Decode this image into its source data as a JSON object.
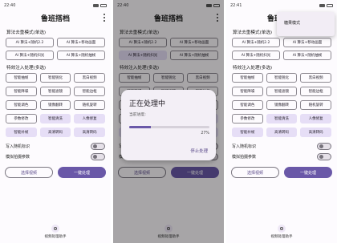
{
  "time": "22:40",
  "time3": "22:41",
  "title": "鲁班搭档",
  "section1": "算法去重模式(单选)",
  "algo": [
    "AI 算法+随机2.2",
    "AI 算法+移动画面",
    "AI 算法+随机扫光",
    "AI 算法+随机抽帧"
  ],
  "section2": "特效注入处理(多选)",
  "effects": [
    "智能抽帧",
    "智能锐化",
    "黑白视频",
    "智能降噪",
    "智能滤镜",
    "智能边框",
    "智能调色",
    "镜像翻转",
    "随机旋转",
    "参数修改",
    "智能清洗",
    "人像修复",
    "智能补帧",
    "高清转码",
    "高清转码"
  ],
  "toggle1": "写入随机标识",
  "toggle2": "模拟拍摄参数",
  "btn_select": "选择视频",
  "btn_process": "一键处理",
  "bottom_label": "视频处理助手",
  "dialog": {
    "title": "正在处理中",
    "message": "当前进度:",
    "percent": "27%",
    "progress": 0.27,
    "stop": "停止处理"
  },
  "popup_item": "糖果模式",
  "colors": {
    "accent": "#6a58a8",
    "chip_selected": "#e6def6"
  }
}
